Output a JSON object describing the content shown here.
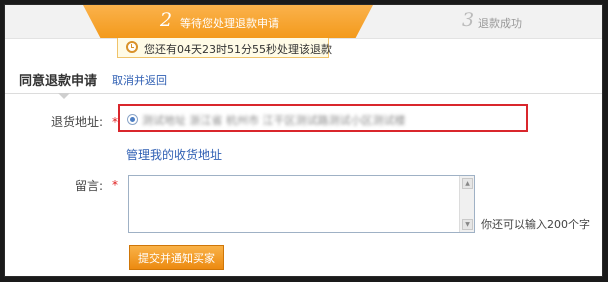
{
  "steps": [
    {
      "number": "2",
      "label": "等待您处理退款申请",
      "state": "active"
    },
    {
      "number": "3",
      "label": "退款成功",
      "state": "pending"
    }
  ],
  "timer": {
    "text": "您还有04天23时51分55秒处理该退款"
  },
  "section": {
    "title": "同意退款申请",
    "cancel_link": "取消并返回"
  },
  "form": {
    "address_label": "退货地址:",
    "address_value": "测试地址 浙江省 杭州市 江干区测试路测试小区测试楼",
    "manage_link": "管理我的收货地址",
    "message_label": "留言:",
    "message_value": "",
    "message_hint": "你还可以输入200个字",
    "submit_label": "提交并通知买家"
  },
  "colors": {
    "accent": "#f39a1c",
    "link": "#2f5fb3",
    "required": "#e02020",
    "highlight_border": "#d9262c"
  }
}
